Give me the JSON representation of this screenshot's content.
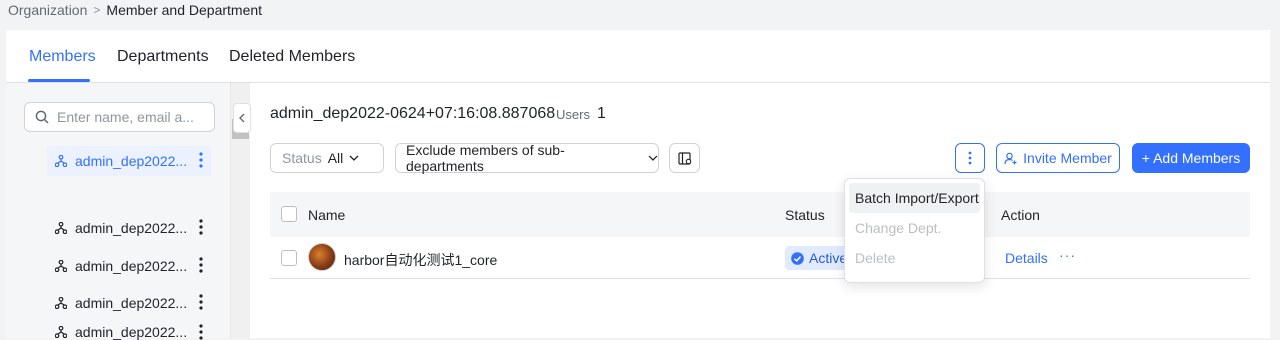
{
  "breadcrumb": {
    "root": "Organization",
    "current": "Member and Department"
  },
  "tabs": [
    {
      "label": "Members",
      "active": true
    },
    {
      "label": "Departments",
      "active": false
    },
    {
      "label": "Deleted Members",
      "active": false
    }
  ],
  "sidebar": {
    "search_placeholder": "Enter name, email a...",
    "items": [
      {
        "label": "admin_dep2022...",
        "selected": true
      },
      {
        "label": "admin_dep2022...",
        "selected": false
      },
      {
        "label": "admin_dep2022...",
        "selected": false
      },
      {
        "label": "admin_dep2022...",
        "selected": false
      },
      {
        "label": "admin_dep2022...",
        "selected": false
      }
    ]
  },
  "main": {
    "department_name": "admin_dep2022-0624+07:16:08.887068",
    "users_label": "Users",
    "users_count": "1",
    "status_filter": {
      "label": "Status",
      "value": "All"
    },
    "scope_filter": "Exclude members of sub-departments",
    "invite_label": "Invite Member",
    "add_label": "+ Add Members"
  },
  "table": {
    "columns": {
      "name": "Name",
      "status": "Status",
      "action": "Action"
    },
    "rows": [
      {
        "name": "harbor自动化测试1_core",
        "status": "Active",
        "details": "Details",
        "more": "···"
      }
    ]
  },
  "dropdown": {
    "items": [
      {
        "label": "Batch Import/Export",
        "enabled": true
      },
      {
        "label": "Change Dept.",
        "enabled": false
      },
      {
        "label": "Delete",
        "enabled": false
      }
    ]
  },
  "colors": {
    "accent": "#3370ff",
    "status_bg": "#e1eaff",
    "selected_bg": "#ebf1ff"
  }
}
